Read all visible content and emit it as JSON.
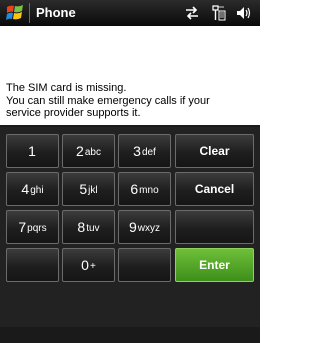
{
  "titlebar": {
    "title": "Phone",
    "icons": [
      "windows-start-logo",
      "sync-arrows-icon",
      "no-sim-antenna-icon",
      "speaker-volume-icon"
    ]
  },
  "message": {
    "line1": "The SIM card is missing.",
    "line2": "You can still make emergency calls if your",
    "line3": "service provider supports it."
  },
  "keypad": {
    "keys": [
      {
        "digit": "1",
        "letters": ""
      },
      {
        "digit": "2",
        "letters": "abc"
      },
      {
        "digit": "3",
        "letters": "def"
      },
      {
        "digit": "4",
        "letters": "ghi"
      },
      {
        "digit": "5",
        "letters": "jkl"
      },
      {
        "digit": "6",
        "letters": "mno"
      },
      {
        "digit": "7",
        "letters": "pqrs"
      },
      {
        "digit": "8",
        "letters": "tuv"
      },
      {
        "digit": "9",
        "letters": "wxyz"
      },
      {
        "digit": "0",
        "letters": "+"
      }
    ],
    "clear_label": "Clear",
    "cancel_label": "Cancel",
    "enter_label": "Enter"
  },
  "colors": {
    "keypad_bg": "#222222",
    "enter_green": "#5aae2c",
    "titlebar_bg": "#1a1a1a"
  }
}
